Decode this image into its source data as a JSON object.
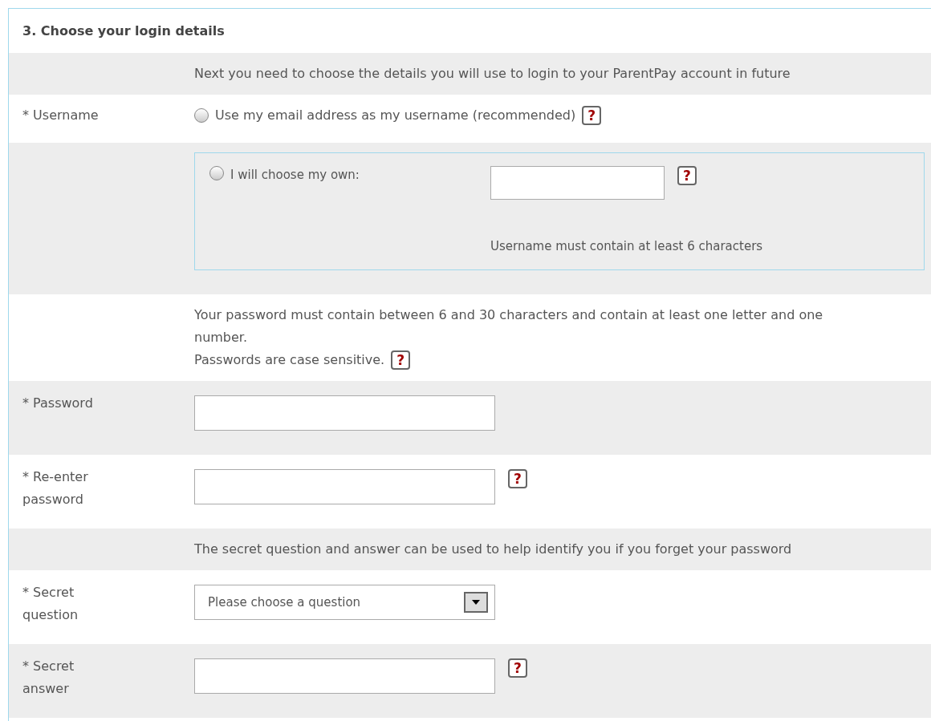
{
  "section_title": "3. Choose your login details",
  "rows": [
    {
      "kind": "note",
      "lines": [
        "Next you need to choose the details you will use to login to your ParentPay account in future"
      ]
    },
    {
      "kind": "radio",
      "label": "* Username",
      "option": {
        "text": "Use my email address as my username (recommended)",
        "selected": false
      },
      "help": "?"
    },
    {
      "kind": "choose_own",
      "option": {
        "text": "I will choose my own:",
        "selected": false
      },
      "hint": "Username must contain at least 6 characters",
      "help": "?"
    },
    {
      "kind": "note",
      "lines": [
        "Your password must contain between 6 and 30 characters and contain at least one letter and one number.",
        "Passwords are case sensitive."
      ],
      "help": "?"
    },
    {
      "kind": "input",
      "label": "* Password"
    },
    {
      "kind": "input",
      "label": "* Re-enter password",
      "help": "?"
    },
    {
      "kind": "note",
      "lines": [
        "The secret question and answer can be used to help identify you if you forget your password"
      ]
    },
    {
      "kind": "select",
      "label": "* Secret question",
      "placeholder": "Please choose a question"
    },
    {
      "kind": "input",
      "label": "* Secret answer",
      "help": "?"
    }
  ]
}
